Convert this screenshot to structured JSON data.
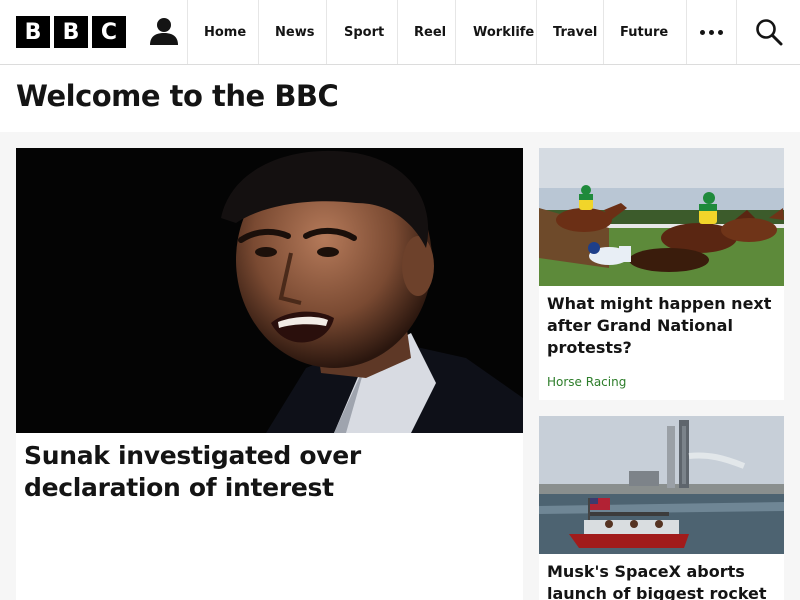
{
  "header": {
    "logo_letters": [
      "B",
      "B",
      "C"
    ],
    "nav": [
      "Home",
      "News",
      "Sport",
      "Reel",
      "Worklife",
      "Travel",
      "Future"
    ]
  },
  "page": {
    "title": "Welcome to the BBC"
  },
  "lead_story": {
    "title": "Sunak investigated over declaration of interest"
  },
  "side_stories": [
    {
      "title": "What might happen next after Grand National protests?",
      "tag": "Horse Racing"
    },
    {
      "title": "Musk's SpaceX aborts launch of biggest rocket"
    }
  ],
  "colors": {
    "tag": "#2d7d2a"
  },
  "icons": {
    "account": "user-account-icon",
    "more": "more-menu-icon",
    "search": "search-icon"
  }
}
